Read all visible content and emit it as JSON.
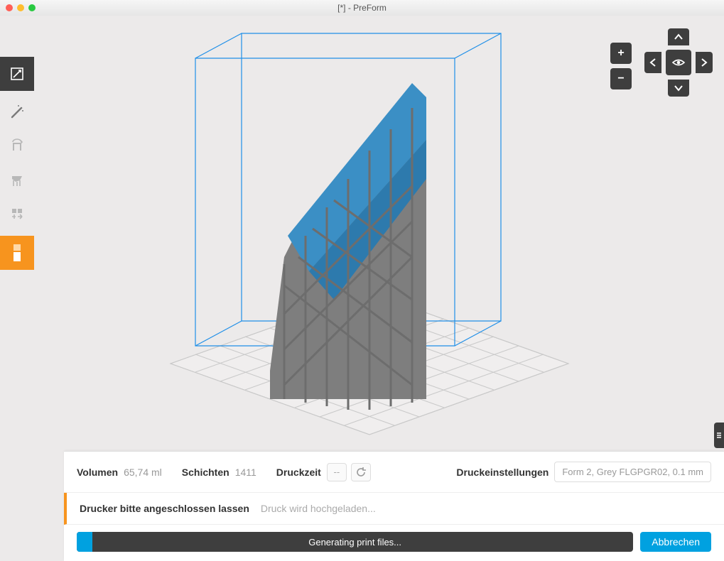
{
  "window": {
    "title": "[*] - PreForm"
  },
  "toolbar_left": {
    "items": [
      {
        "name": "size-tool",
        "active": false,
        "dark": true
      },
      {
        "name": "magic-tool",
        "active": false,
        "dark": false
      },
      {
        "name": "orient-tool",
        "active": false,
        "dark": false
      },
      {
        "name": "supports-tool",
        "active": false,
        "dark": false
      },
      {
        "name": "layout-tool",
        "active": false,
        "dark": false
      },
      {
        "name": "print-tool",
        "active": true,
        "dark": false
      }
    ]
  },
  "orbit": {
    "zoom_in": "+",
    "zoom_out": "−"
  },
  "bottom": {
    "volume_label": "Volumen",
    "volume_value": "65,74 ml",
    "layers_label": "Schichten",
    "layers_value": "1411",
    "time_label": "Druckzeit",
    "time_value": "--",
    "settings_label": "Druckeinstellungen",
    "settings_value": "Form 2, Grey FLGPGR02, 0.1 mm",
    "connect_bold": "Drucker bitte angeschlossen lassen",
    "connect_light": "Druck wird hochgeladen...",
    "progress_text": "Generating print files...",
    "cancel": "Abbrechen"
  }
}
